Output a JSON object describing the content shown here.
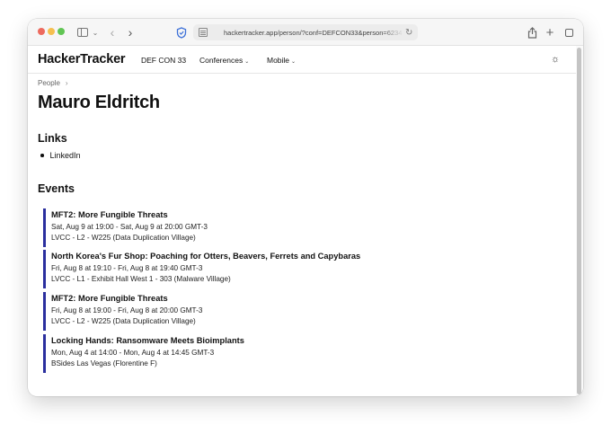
{
  "browser": {
    "url": "hackertracker.app/person/?conf=DEFCON33&person=62347"
  },
  "header": {
    "brand": "HackerTracker",
    "nav": {
      "current_conf": "DEF CON 33",
      "conferences": "Conferences",
      "mobile": "Mobile"
    },
    "theme_icon": "sun-icon"
  },
  "breadcrumb": {
    "people": "People",
    "separator": "›"
  },
  "person": {
    "name": "Mauro Eldritch"
  },
  "links": {
    "heading": "Links",
    "items": [
      {
        "label": "LinkedIn"
      }
    ]
  },
  "events": {
    "heading": "Events",
    "accent_color": "#2b2f9e",
    "items": [
      {
        "title": "MFT2: More Fungible Threats",
        "time": "Sat, Aug 9 at 19:00 - Sat, Aug 9 at 20:00 GMT-3",
        "location": "LVCC - L2 - W225 (Data Duplication Village)"
      },
      {
        "title": "North Korea's Fur Shop: Poaching for Otters, Beavers, Ferrets and Capybaras",
        "time": "Fri, Aug 8 at 19:10 - Fri, Aug 8 at 19:40 GMT-3",
        "location": "LVCC - L1 - Exhibit Hall West 1 - 303 (Malware Village)"
      },
      {
        "title": "MFT2: More Fungible Threats",
        "time": "Fri, Aug 8 at 19:00 - Fri, Aug 8 at 20:00 GMT-3",
        "location": "LVCC - L2 - W225 (Data Duplication Village)"
      },
      {
        "title": "Locking Hands: Ransomware Meets Bioimplants",
        "time": "Mon, Aug 4 at 14:00 - Mon, Aug 4 at 14:45 GMT-3",
        "location": "BSides Las Vegas (Florentine F)"
      }
    ]
  }
}
